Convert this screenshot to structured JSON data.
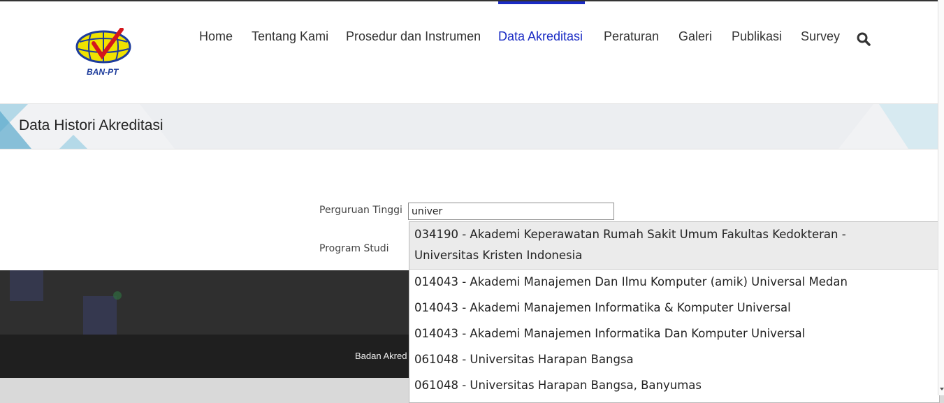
{
  "logo": {
    "text": "BAN-PT"
  },
  "nav": {
    "items": [
      {
        "label": "Home"
      },
      {
        "label": "Tentang Kami"
      },
      {
        "label": "Prosedur dan Instrumen"
      },
      {
        "label": "Data Akreditasi",
        "active": true
      },
      {
        "label": "Peraturan"
      },
      {
        "label": "Galeri"
      },
      {
        "label": "Publikasi"
      },
      {
        "label": "Survey"
      }
    ],
    "search_icon": "search-icon"
  },
  "page": {
    "title": "Data Histori Akreditasi"
  },
  "form": {
    "pt_label": "Perguruan Tinggi",
    "pt_value": "univer",
    "prodi_label": "Program Studi"
  },
  "dropdown": {
    "options": [
      {
        "line1": "034190 - Akademi Keperawatan Rumah Sakit Umum Fakultas Kedokteran -",
        "line2": "Universitas Kristen Indonesia"
      },
      {
        "line1": "014043 - Akademi Manajemen Dan Ilmu Komputer (amik) Universal Medan"
      },
      {
        "line1": "014043 - Akademi Manajemen Informatika & Komputer Universal"
      },
      {
        "line1": "014043 - Akademi Manajemen Informatika Dan Komputer Universal"
      },
      {
        "line1": "061048 - Universitas Harapan Bangsa"
      },
      {
        "line1": "061048 - Universitas Harapan Bangsa, Banyumas"
      }
    ]
  },
  "footer": {
    "text": "Badan Akred"
  },
  "colors": {
    "accent": "#1a2bc4",
    "dark": "#2f2f2f",
    "footer": "#1f1f1f"
  }
}
